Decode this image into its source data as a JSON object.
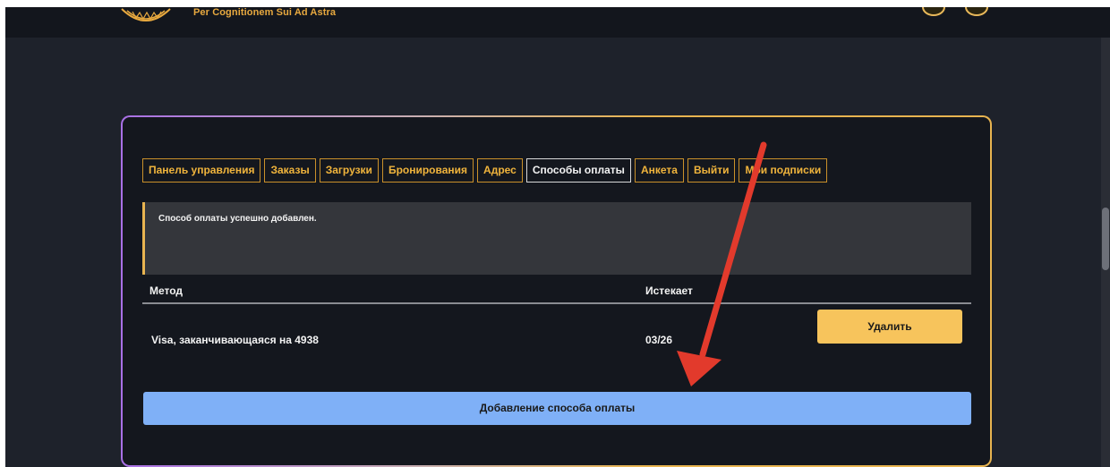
{
  "header": {
    "tagline": "Per Cognitionem Sui Ad Astra",
    "icons": [
      "logo-emblem",
      "cart-icon",
      "user-icon"
    ]
  },
  "account": {
    "tabs": [
      {
        "label": "Панель управления"
      },
      {
        "label": "Заказы"
      },
      {
        "label": "Загрузки"
      },
      {
        "label": "Бронирования"
      },
      {
        "label": "Адрес"
      },
      {
        "label": "Способы оплаты",
        "active": true
      },
      {
        "label": "Анкета"
      },
      {
        "label": "Выйти"
      },
      {
        "label": "Мои подписки"
      }
    ],
    "notice": "Способ оплаты успешно добавлен.",
    "table": {
      "headers": {
        "method": "Метод",
        "expires": "Истекает"
      },
      "rows": [
        {
          "method": "Visa, заканчивающаяся на 4938",
          "expires": "03/26",
          "action": "Удалить"
        }
      ]
    },
    "add_button": "Добавление способа оплаты"
  },
  "colors": {
    "background": "#1e222b",
    "card": "#14171e",
    "accent_gold": "#f0b43c",
    "delete_button": "#f7c45c",
    "add_button": "#7fb0f7",
    "annotation_arrow": "#e23a2c"
  }
}
